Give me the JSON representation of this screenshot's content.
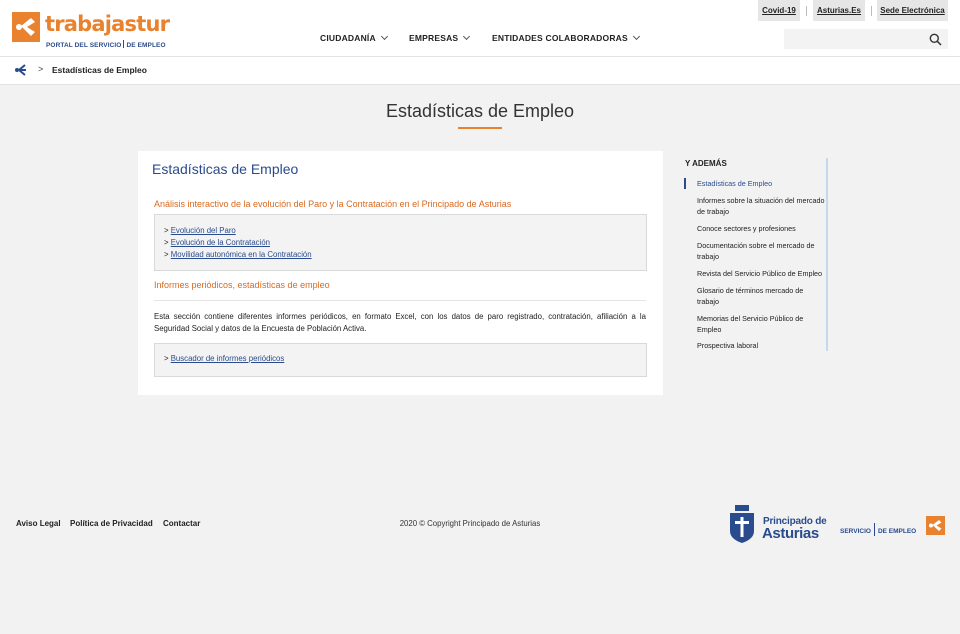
{
  "header": {
    "logo": {
      "brand_text": "trabajastur",
      "tagline_left": "PORTAL DEL SERVICIO",
      "tagline_right": "DE EMPLEO",
      "color": "#e8822e"
    },
    "nav": [
      {
        "label": "CIUDADANÍA"
      },
      {
        "label": "EMPRESAS"
      },
      {
        "label": "ENTIDADES COLABORADORAS"
      }
    ],
    "top_links": [
      {
        "label": "Covid-19"
      },
      {
        "label": "Asturias.Es"
      },
      {
        "label": "Sede Electrónica"
      }
    ],
    "search": {
      "placeholder": "",
      "icon": "search-icon"
    }
  },
  "breadcrumb": {
    "home_icon": "home-network-icon",
    "separator": ">",
    "current": "Estadísticas de Empleo"
  },
  "page_title": "Estadísticas de Empleo",
  "main": {
    "heading": "Estadísticas de Empleo",
    "section1": {
      "title": "Análisis interactivo de la evolución del Paro y la Contratación en el Principado de Asturias",
      "links": [
        {
          "prefix": ">",
          "label": "Evolución del Paro"
        },
        {
          "prefix": ">",
          "label": "Evolución de la Contratación"
        },
        {
          "prefix": ">",
          "label": "Movilidad autonómica en la Contratación"
        }
      ]
    },
    "section2": {
      "title": "Informes periódicos, estadísticas de empleo",
      "text": "Esta sección contiene diferentes informes periódicos, en formato Excel, con los datos de paro registrado, contratación, afiliación a la Seguridad Social y datos de la Encuesta de Población Activa.",
      "links": [
        {
          "prefix": ">",
          "label": "Buscador de informes periódicos"
        }
      ]
    }
  },
  "sidebar": {
    "title": "Y ADEMÁS",
    "items": [
      {
        "label": "Estadísticas de Empleo",
        "active": true
      },
      {
        "label": "Informes sobre la situación del mercado de trabajo"
      },
      {
        "label": "Conoce sectores y profesiones"
      },
      {
        "label": "Documentación sobre el mercado de trabajo"
      },
      {
        "label": "Revista del Servicio Público de Empleo"
      },
      {
        "label": "Glosario de términos mercado de trabajo"
      },
      {
        "label": "Memorias del Servicio Público de Empleo"
      },
      {
        "label": "Prospectiva laboral"
      }
    ]
  },
  "footer": {
    "links": [
      {
        "label": "Aviso Legal"
      },
      {
        "label": "Política de Privacidad"
      },
      {
        "label": "Contactar"
      }
    ],
    "copyright": "2020 © Copyright Principado de Asturias",
    "principado": {
      "line1": "Principado de",
      "line2": "Asturias"
    },
    "servicio": {
      "left": "SERVICIO",
      "right": "DE EMPLEO"
    }
  },
  "colors": {
    "accent": "#e8822e",
    "primary": "#2a4b8d",
    "background": "#f2f2f2"
  }
}
